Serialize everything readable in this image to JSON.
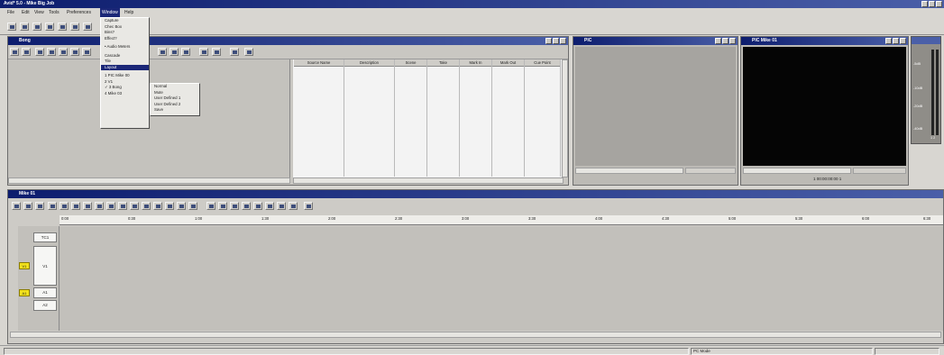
{
  "app": {
    "title": "Avid* 5.0 - Mike Big Job"
  },
  "menubar": [
    "File",
    "Edit",
    "View",
    "Tools",
    "Preferences",
    "Window",
    "Help"
  ],
  "window_menu": {
    "items": [
      "Capture",
      "Chec Box",
      "Bins?",
      "Effect?",
      "",
      "• Audio Meters",
      "",
      "Cascade",
      "Tile",
      "Layout",
      "",
      "1 PIC Mike 00",
      "2 V1",
      "✓ 3 Bong",
      "4 Mike 03"
    ],
    "highlighted": "Layout"
  },
  "layout_submenu": [
    "Normal",
    "Mute",
    "User Defined 1",
    "User Defined 2",
    "Save"
  ],
  "bin": {
    "title": "Bong",
    "columns": [
      "Source Name",
      "Description",
      "Scene",
      "Take",
      "Mark In",
      "Mark Out",
      "Cue Point"
    ]
  },
  "source_monitor": {
    "title": "PIC"
  },
  "record_monitor": {
    "title": "PIC Mike 01",
    "timecode": "1 00:00:00:00 1"
  },
  "timeline": {
    "title": "Mike 01",
    "ruler": [
      "0:00",
      "0:30",
      "1:00",
      "1:30",
      "2:00",
      "2:30",
      "3:00",
      "3:30",
      "4:00",
      "4:30",
      "5:00",
      "5:30",
      "6:00",
      "6:30"
    ],
    "tracks": [
      "TC1",
      "V1",
      "A1",
      "A2"
    ],
    "patches": [
      "V1",
      "A1"
    ]
  },
  "audio_meter": {
    "labels": [
      "-5dB",
      "-10dB",
      "-20dB",
      "-40dB"
    ],
    "channels": "1 2"
  },
  "statusbar": {
    "mode": "PC Mode"
  }
}
